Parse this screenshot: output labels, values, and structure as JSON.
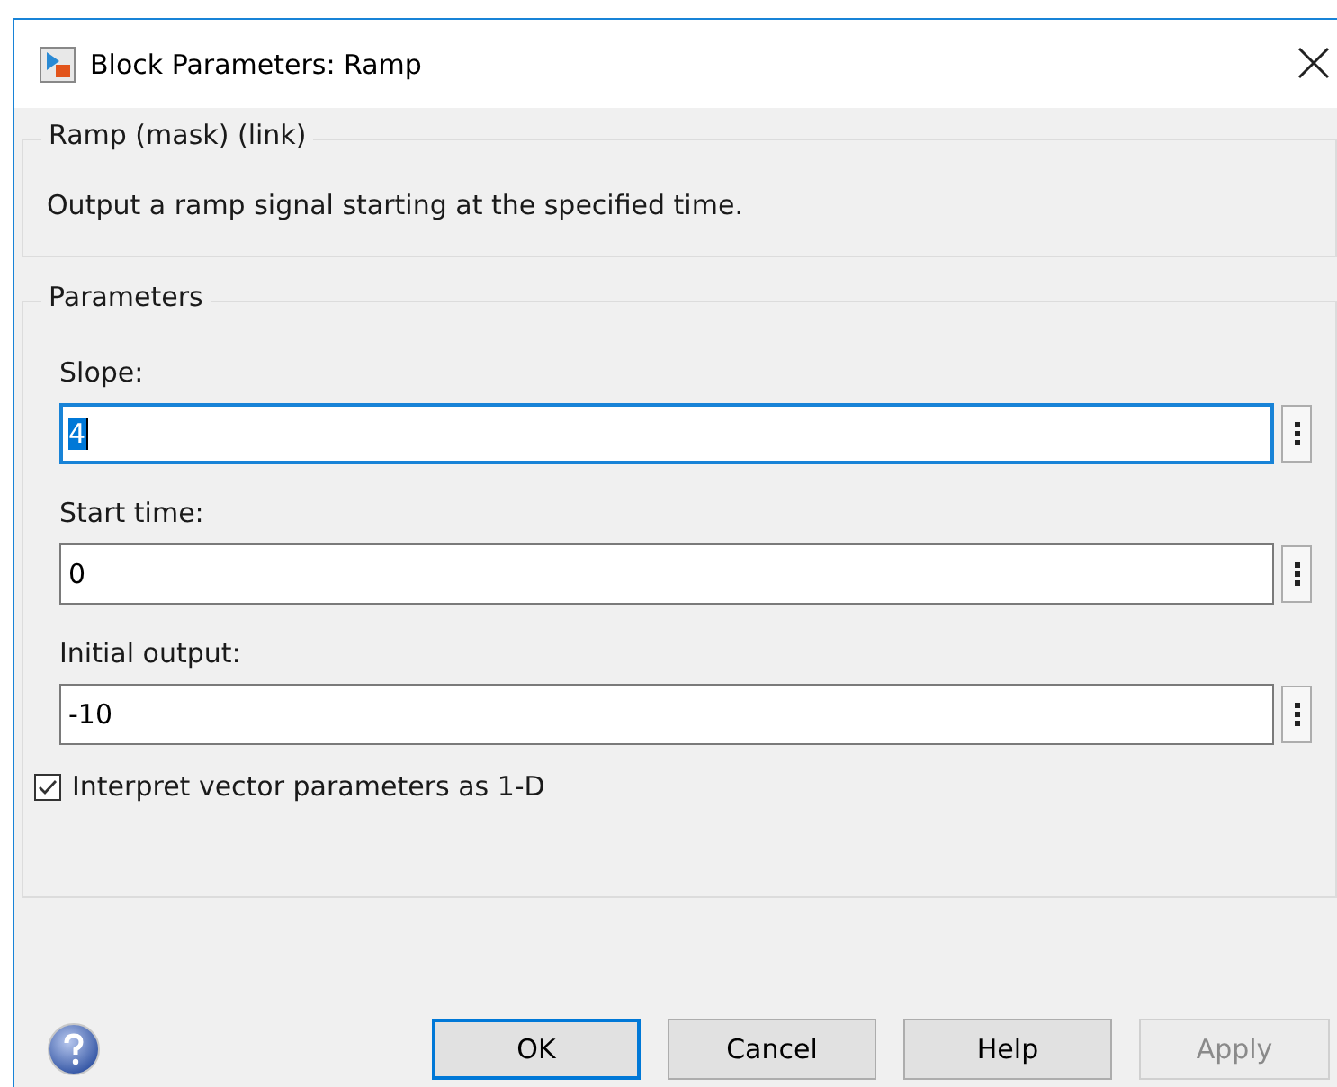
{
  "window": {
    "title": "Block Parameters: Ramp"
  },
  "description_group": {
    "title": "Ramp (mask) (link)",
    "text": "Output a ramp signal starting at the specified time."
  },
  "parameters_group": {
    "title": "Parameters",
    "fields": [
      {
        "label": "Slope:",
        "value": "4",
        "focused": true
      },
      {
        "label": "Start time:",
        "value": "0",
        "focused": false
      },
      {
        "label": "Initial output:",
        "value": "-10",
        "focused": false
      }
    ],
    "checkbox": {
      "label": "Interpret vector parameters as 1-D",
      "checked": true
    }
  },
  "buttons": [
    {
      "label": "OK",
      "default": true,
      "disabled": false
    },
    {
      "label": "Cancel",
      "default": false,
      "disabled": false
    },
    {
      "label": "Help",
      "default": false,
      "disabled": false
    },
    {
      "label": "Apply",
      "default": false,
      "disabled": true
    }
  ]
}
